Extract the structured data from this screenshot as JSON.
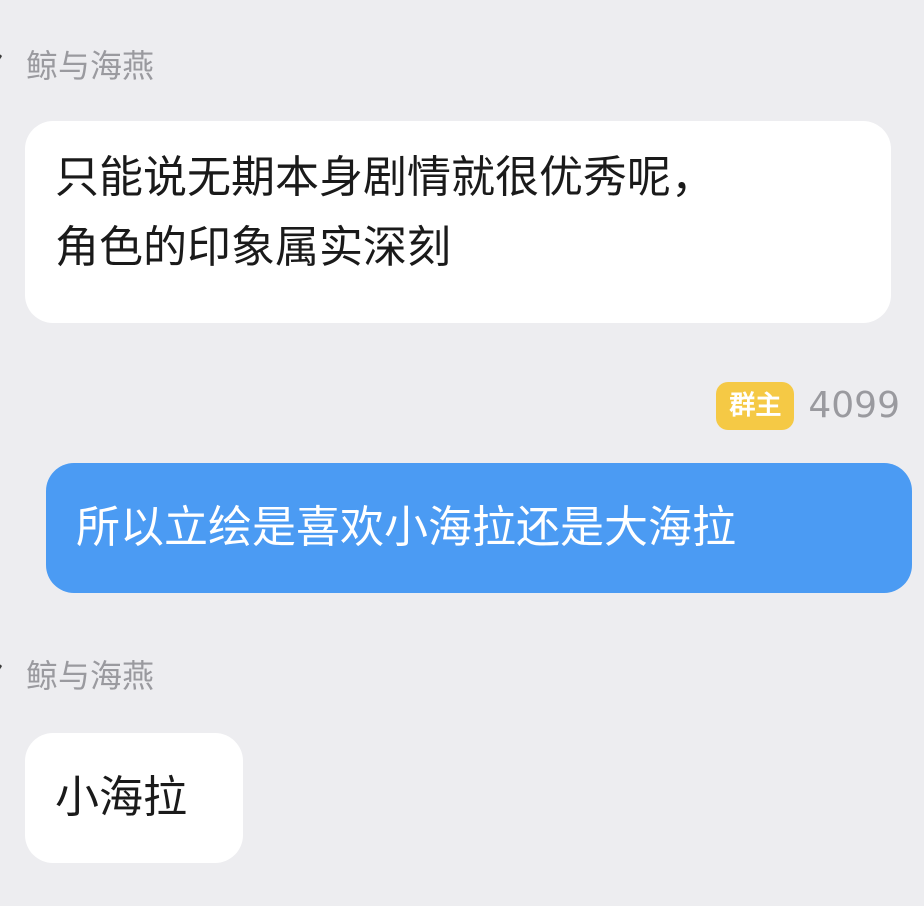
{
  "messages": [
    {
      "sender": "鲸与海燕",
      "lines": [
        "只能说无期本身剧情就很优秀呢，",
        "角色的印象属实深刻"
      ]
    },
    {
      "sender": "4099",
      "badge": "群主",
      "text": "所以立绘是喜欢小海拉还是大海拉"
    },
    {
      "sender": "鲸与海燕",
      "text": "小海拉"
    }
  ],
  "colors": {
    "background": "#ededf0",
    "self_bubble": "#4b9bf3",
    "other_bubble": "#ffffff",
    "badge": "#f5c945",
    "name_text": "#9a9a9f"
  }
}
